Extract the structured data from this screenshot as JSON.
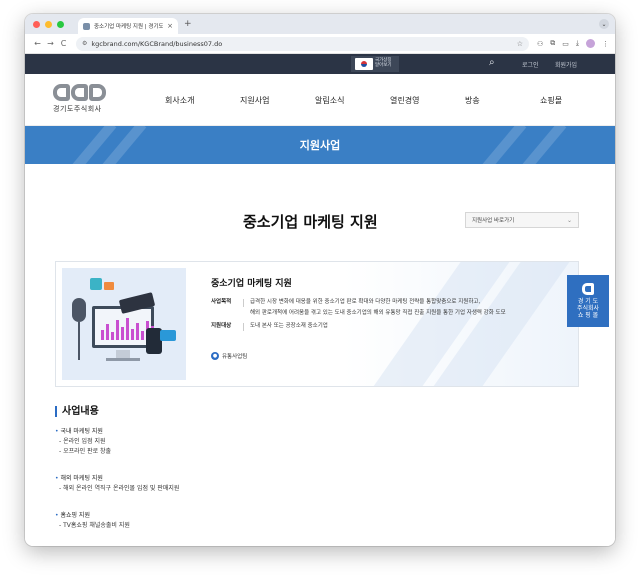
{
  "browser": {
    "tab_title": "중소기업 마케팅 지원 | 경기도주식회사",
    "tab_close": "×",
    "new_tab": "+",
    "dropdown": "⌄",
    "url": "kgcbrand.com/KGCBrand/business07.do",
    "nav": {
      "back": "←",
      "forward": "→",
      "reload": "C"
    }
  },
  "site": {
    "topbar": {
      "flag_text": "국가상징 알아보기",
      "login": "로그인",
      "signup": "회원가입"
    },
    "logo_text": "경기도주식회사",
    "gnb": [
      "회사소개",
      "지원사업",
      "알림소식",
      "열린경영",
      "방송",
      "쇼핑몰"
    ],
    "banner_title": "지원사업",
    "page_title": "중소기업 마케팅 지원",
    "quick_select": "지원사업 바로가기",
    "card": {
      "title": "중소기업 마케팅 지원",
      "purpose_label": "사업목적",
      "purpose_line1": "급격한 시장 변화에 대응을 위한 중소기업 판로 확대와 다양한 마케팅 전략을 통합맞춤으로 지원하고,",
      "purpose_line2": "해외 판로개척에 어려움을 겪고 있는 도내 중소기업의 해외 유통망 직접 진출 지원을 통한 기업 자생력 강화 도모",
      "target_label": "지원대상",
      "target_value": "도내 본사 또는 공장소재 중소기업",
      "dept": "유통사업팀"
    },
    "side_badge": {
      "line1": "경 기 도",
      "line2": "주식회사",
      "line3": "쇼 핑 몰"
    },
    "biz": {
      "title": "사업내용",
      "groups": [
        {
          "item": "국내 마케팅 지원",
          "subs": [
            "온라인 입점 지원",
            "오프라인 판로 창출"
          ]
        },
        {
          "item": "해외 마케팅 지원",
          "subs": [
            "해외 온라인 역직구 온라인몰 입점 및 판매지원"
          ]
        },
        {
          "item": "홈쇼핑 지원",
          "subs": [
            "TV홈쇼핑 채널송출비 지원"
          ]
        }
      ]
    }
  }
}
